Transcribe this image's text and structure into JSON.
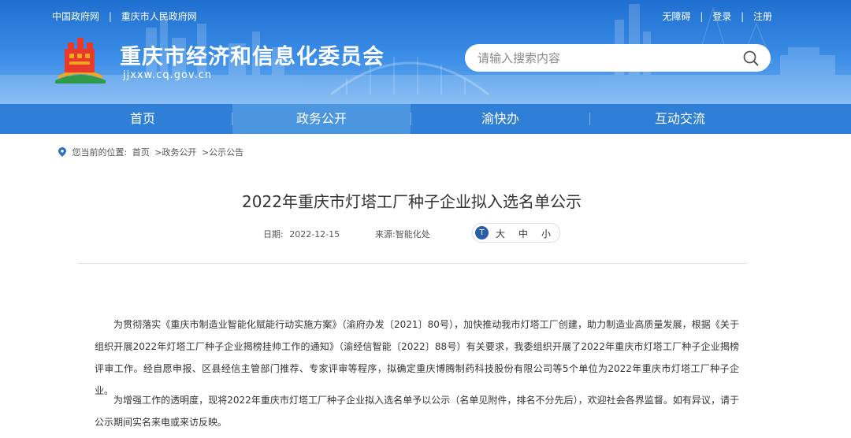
{
  "header": {
    "top_left_links": [
      "中国政府网",
      "|",
      "重庆市人民政府网"
    ],
    "top_right_links": [
      "无障碍",
      "|",
      "登录",
      "|",
      "注册"
    ],
    "site_title": "重庆市经济和信息化委员会",
    "site_url": "jjxxw.cq.gov.cn",
    "search_placeholder": "请输入搜索内容"
  },
  "nav": {
    "items": [
      {
        "label": "首页",
        "active": false
      },
      {
        "label": "政务公开",
        "active": true
      },
      {
        "label": "渝快办",
        "active": false
      },
      {
        "label": "互动交流",
        "active": false
      }
    ]
  },
  "breadcrumb": {
    "prefix": "您当前的位置:",
    "items": [
      "首页",
      ">政务公开",
      ">公示公告"
    ]
  },
  "article": {
    "title": "2022年重庆市灯塔工厂种子企业拟入选名单公示",
    "date_label": "日期:",
    "date_value": "2022-12-15",
    "source_label": "来源:",
    "source_value": "智能化处",
    "font_size_options": [
      "大",
      "中",
      "小"
    ],
    "paragraphs": [
      "为贯彻落实《重庆市制造业智能化赋能行动实施方案》（渝府办发〔2021〕80号），加快推动我市灯塔工厂创建，助力制造业高质量发展，根据《关于组织开展2022年灯塔工厂种子企业揭榜挂帅工作的通知》（渝经信智能〔2022〕88号）有关要求，我委组织开展了2022年重庆市灯塔工厂种子企业揭榜评审工作。经自愿申报、区县经信主管部门推荐、专家评审等程序，拟确定重庆博腾制药科技股份有限公司等5个单位为2022年重庆市灯塔工厂种子企业。",
      "为增强工作的透明度，现将2022年重庆市灯塔工厂种子企业拟入选名单予以公示（名单见附件，排名不分先后），欢迎社会各界监督。如有异议，请于公示期间实名来电或来访反映。"
    ]
  },
  "colors": {
    "header_blue": "#2f7fd6",
    "nav_active": "#4c95df",
    "logo_red": "#e83a2a",
    "logo_orange": "#f6a51e",
    "logo_green": "#2f9a47"
  },
  "icons": [
    "search-icon",
    "location-pin-icon",
    "font-size-icon",
    "site-logo-icon"
  ]
}
